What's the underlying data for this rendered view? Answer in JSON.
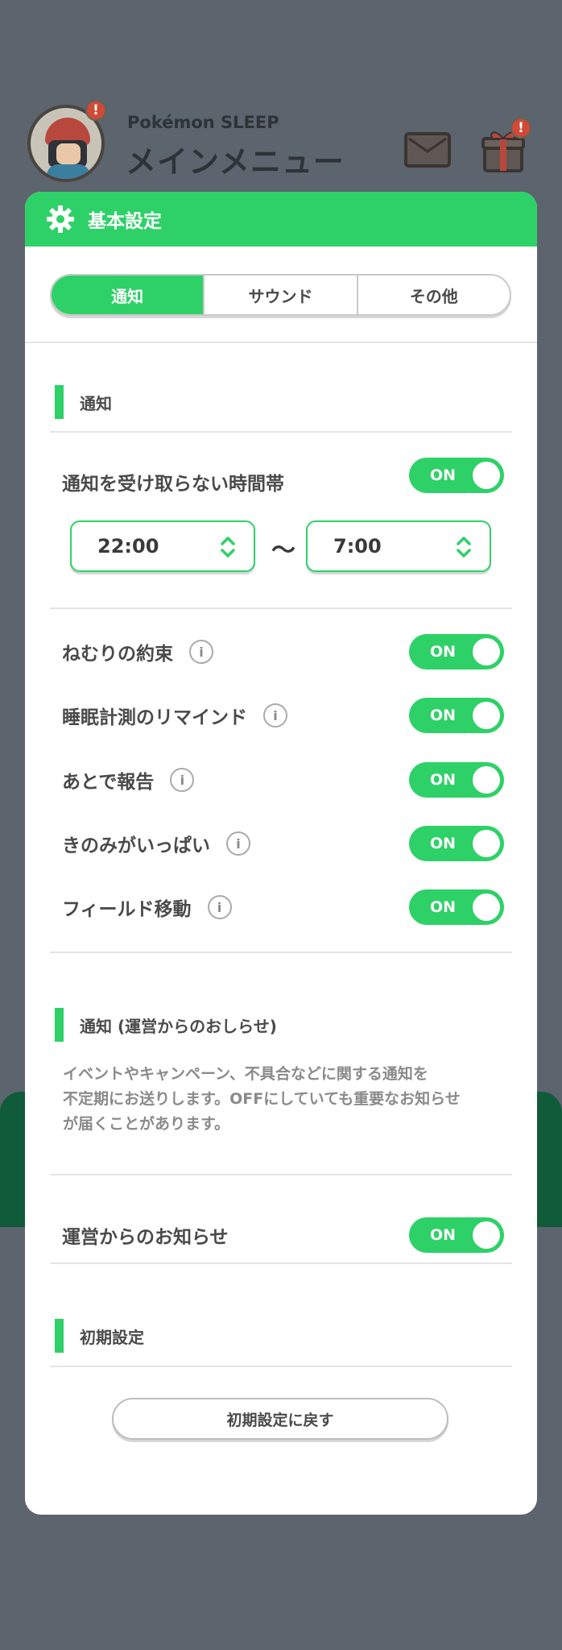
{
  "header": {
    "app_subtitle": "Pokémon SLEEP",
    "app_title": "メインメニュー",
    "badge_mark": "!"
  },
  "sheet": {
    "title": "基本設定",
    "tabs": [
      {
        "label": "通知",
        "active": true
      },
      {
        "label": "サウンド",
        "active": false
      },
      {
        "label": "その他",
        "active": false
      }
    ]
  },
  "notifications": {
    "section_title": "通知",
    "quiet_hours": {
      "label": "通知を受け取らない時間帯",
      "state": "ON",
      "start": "22:00",
      "separator": "～",
      "end": "7:00"
    },
    "items": [
      {
        "label": "ねむりの約束",
        "state": "ON"
      },
      {
        "label": "睡眠計測のリマインド",
        "state": "ON"
      },
      {
        "label": "あとで報告",
        "state": "ON"
      },
      {
        "label": "きのみがいっぱい",
        "state": "ON"
      },
      {
        "label": "フィールド移動",
        "state": "ON"
      }
    ],
    "info_glyph": "i"
  },
  "operator": {
    "section_title": "通知 (運営からのおしらせ)",
    "description_lines": [
      "イベントやキャンペーン、不具合などに関する通知を",
      "不定期にお送りします。OFFにしていても重要なお知らせ",
      "が届くことがあります。"
    ],
    "item": {
      "label": "運営からのお知らせ",
      "state": "ON"
    }
  },
  "reset": {
    "section_title": "初期設定",
    "button_label": "初期設定に戻す"
  },
  "colors": {
    "accent": "#2ed167",
    "background": "#5c646d",
    "badge": "#d14a36"
  }
}
